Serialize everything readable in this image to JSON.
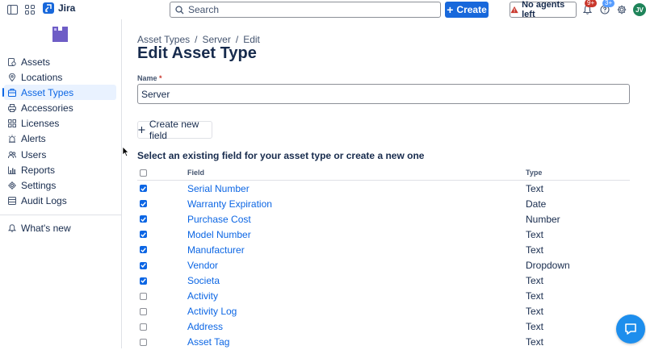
{
  "app": {
    "name": "Jira"
  },
  "search": {
    "placeholder": "Search"
  },
  "topbar": {
    "create_label": "Create",
    "agents_label": "No agents left",
    "notifications_badge": "9+",
    "help_badge": "3+",
    "avatar_initials": "JV"
  },
  "sidebar": {
    "items": [
      {
        "label": "Assets",
        "icon": "assets-icon"
      },
      {
        "label": "Locations",
        "icon": "location-pin-icon"
      },
      {
        "label": "Asset Types",
        "icon": "asset-types-icon"
      },
      {
        "label": "Accessories",
        "icon": "printer-icon"
      },
      {
        "label": "Licenses",
        "icon": "grid-icon"
      },
      {
        "label": "Alerts",
        "icon": "alarm-icon"
      },
      {
        "label": "Users",
        "icon": "users-icon"
      },
      {
        "label": "Reports",
        "icon": "bar-chart-icon"
      },
      {
        "label": "Settings",
        "icon": "gear-icon"
      },
      {
        "label": "Audit Logs",
        "icon": "list-icon"
      }
    ],
    "active_index": 2,
    "whats_new": "What's new"
  },
  "breadcrumb": [
    "Asset Types",
    "Server",
    "Edit"
  ],
  "page_title": "Edit Asset Type",
  "form": {
    "name_label": "Name",
    "required_mark": "*",
    "name_value": "Server",
    "create_field_label": "Create new field",
    "section_heading": "Select an existing field for your asset type or create a new one"
  },
  "table": {
    "headers": {
      "field": "Field",
      "type": "Type"
    },
    "rows": [
      {
        "field": "Serial Number",
        "type": "Text",
        "checked": true
      },
      {
        "field": "Warranty Expiration",
        "type": "Date",
        "checked": true
      },
      {
        "field": "Purchase Cost",
        "type": "Number",
        "checked": true
      },
      {
        "field": "Model Number",
        "type": "Text",
        "checked": true
      },
      {
        "field": "Manufacturer",
        "type": "Text",
        "checked": true
      },
      {
        "field": "Vendor",
        "type": "Dropdown",
        "checked": true
      },
      {
        "field": "Societa",
        "type": "Text",
        "checked": true
      },
      {
        "field": "Activity",
        "type": "Text",
        "checked": false
      },
      {
        "field": "Activity Log",
        "type": "Text",
        "checked": false
      },
      {
        "field": "Address",
        "type": "Text",
        "checked": false
      },
      {
        "field": "Asset Tag",
        "type": "Text",
        "checked": false
      }
    ]
  },
  "colors": {
    "brand": "#1868db",
    "link": "#0c66e4",
    "active_bg": "#e9f2ff",
    "help_fab": "#1d8eed"
  }
}
